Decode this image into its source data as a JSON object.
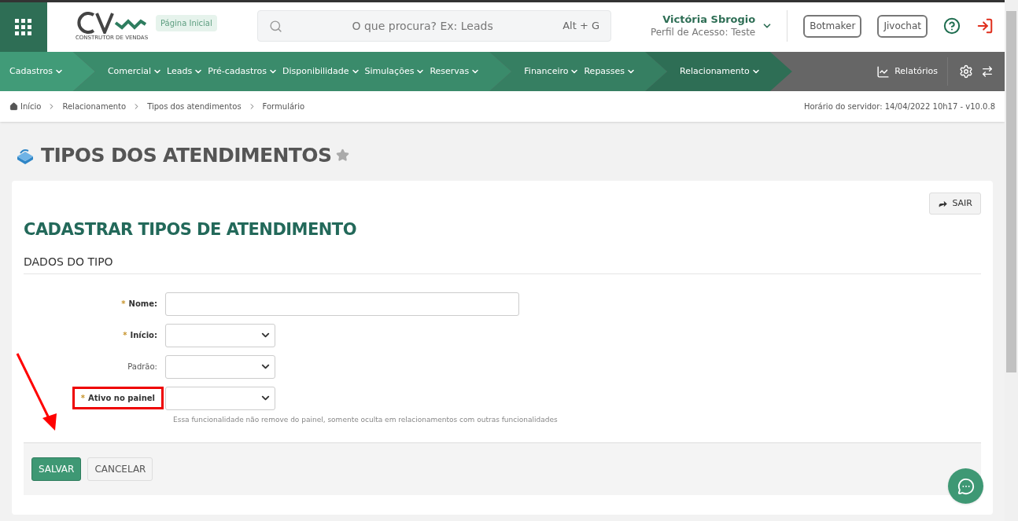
{
  "header": {
    "tooltip": "Página Inicial",
    "logo_text": "CONSTRUTOR DE VENDAS",
    "search": {
      "placeholder": "O que procura? Ex: Leads",
      "shortcut": "Alt + G"
    },
    "user": {
      "name": "Victória Sbrogio",
      "profile": "Perfil de Acesso: Teste"
    },
    "buttons": [
      "Botmaker",
      "Jivochat"
    ]
  },
  "nav": {
    "groups": [
      {
        "selected": false,
        "items": [
          "Cadastros"
        ]
      },
      {
        "selected": false,
        "items": [
          "Comercial",
          "Leads",
          "Pré-cadastros",
          "Disponibilidade",
          "Simulações",
          "Reservas"
        ]
      },
      {
        "selected": false,
        "items": [
          "Financeiro",
          "Repasses"
        ]
      },
      {
        "selected": true,
        "items": [
          "Relacionamento"
        ]
      }
    ],
    "reports": "Relatórios"
  },
  "breadcrumb": [
    "Início",
    "Relacionamento",
    "Tipos dos atendimentos",
    "Formulário"
  ],
  "server_time": "Horário do servidor: 14/04/2022 10h17 - v10.0.8",
  "page_title": "TIPOS DOS ATENDIMENTOS",
  "form": {
    "exit_button": "SAIR",
    "title": "CADASTRAR TIPOS DE ATENDIMENTO",
    "section": "DADOS DO TIPO",
    "fields": [
      {
        "kind": "text",
        "marker": "*",
        "label": "Nome:",
        "highlighted": false
      },
      {
        "kind": "select",
        "marker": "*",
        "label": "Início:",
        "highlighted": false
      },
      {
        "kind": "select",
        "label": "Padrão:",
        "highlighted": false
      },
      {
        "kind": "select",
        "marker": "*",
        "label": "Ativo no painel",
        "highlighted": true,
        "help": "Essa funcionalidade não remove do painel, somente oculta em relacionamentos com outras funcionalidades"
      }
    ],
    "save": "SALVAR",
    "cancel": "CANCELAR"
  }
}
